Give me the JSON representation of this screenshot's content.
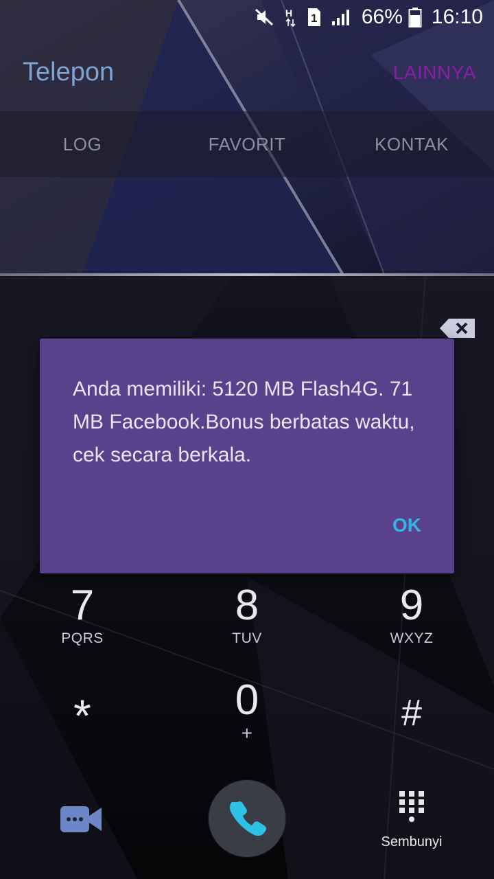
{
  "status_bar": {
    "battery_percent": "66%",
    "time": "16:10",
    "network_type": "H",
    "sim_slot": "1",
    "icons": [
      "mute-icon",
      "network-h-icon",
      "sim-1-icon",
      "signal-icon",
      "battery-icon"
    ]
  },
  "app_bar": {
    "title": "Telepon",
    "more_label": "LAINNYA"
  },
  "tabs": [
    {
      "label": "LOG"
    },
    {
      "label": "FAVORIT"
    },
    {
      "label": "KONTAK"
    }
  ],
  "keypad": {
    "keys": [
      {
        "digit": "7",
        "letters": "PQRS"
      },
      {
        "digit": "8",
        "letters": "TUV"
      },
      {
        "digit": "9",
        "letters": "WXYZ"
      },
      {
        "digit": "*",
        "letters": ""
      },
      {
        "digit": "0",
        "letters": "+"
      },
      {
        "digit": "#",
        "letters": ""
      }
    ]
  },
  "bottom_bar": {
    "hide_label": "Sembunyi",
    "icons": [
      "video-call-icon",
      "phone-icon",
      "dialpad-icon"
    ]
  },
  "dialog": {
    "message": "Anda memiliki: 5120 MB Flash4G. 71 MB Facebook.Bonus berbatas waktu, cek secara berkala.",
    "ok_label": "OK"
  },
  "colors": {
    "dialog_bg": "#5a418b",
    "ok_text": "#33b5e5",
    "title_text": "#7fa3d1",
    "more_text": "#8a1fa6"
  }
}
